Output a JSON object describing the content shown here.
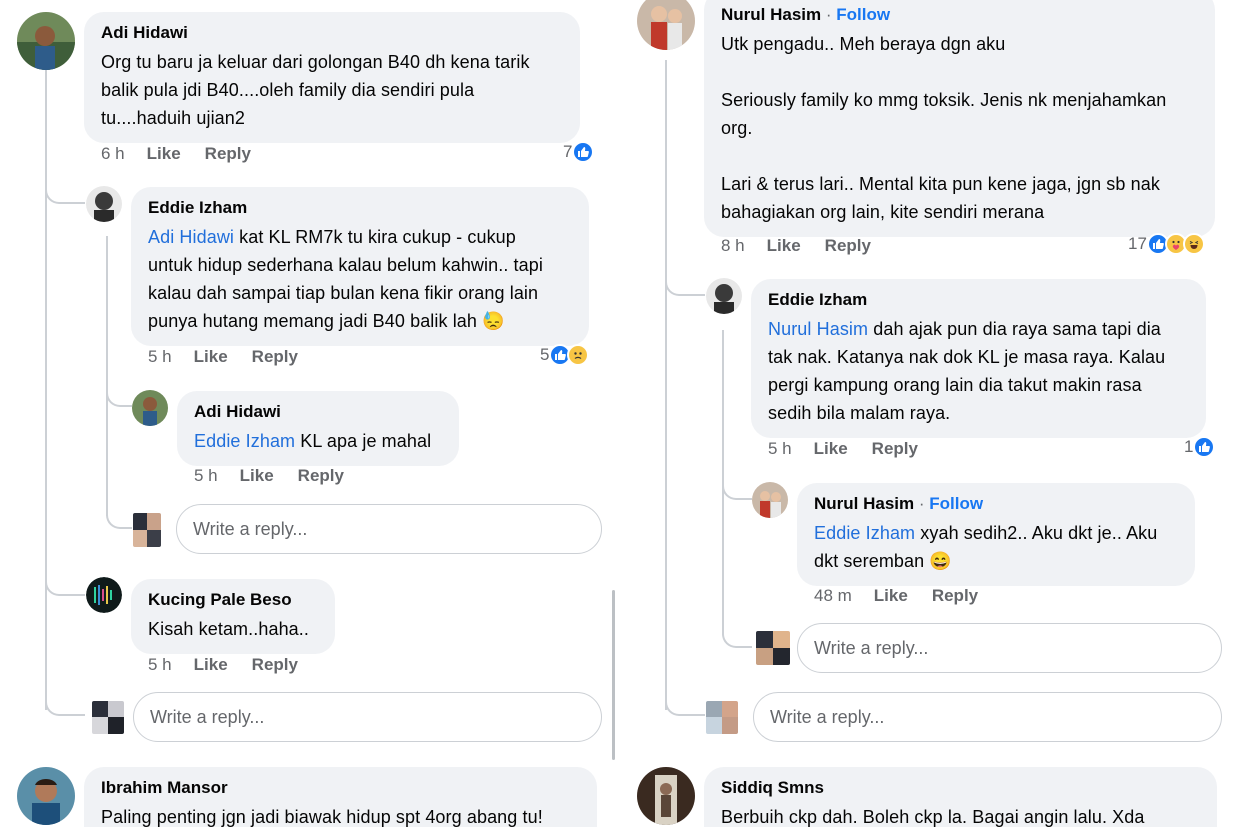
{
  "left": {
    "c1": {
      "author": "Adi Hidawi",
      "text": "Org tu baru ja keluar dari golongan B40 dh kena tarik\nbalik pula jdi B40....oleh family dia sendiri pula\ntu....haduih ujian2",
      "time": "6 h",
      "like": "Like",
      "reply": "Reply",
      "reactions": "7"
    },
    "c2": {
      "author": "Eddie Izham",
      "mention": "Adi Hidawi",
      "text": "  kat KL RM7k tu kira cukup - cukup\nuntuk hidup sederhana kalau belum kahwin.. tapi\nkalau dah sampai tiap bulan kena fikir orang lain\npunya hutang memang jadi B40 balik lah 😓",
      "time": "5 h",
      "like": "Like",
      "reply": "Reply",
      "reactions": "5"
    },
    "c3": {
      "author": "Adi Hidawi",
      "mention": "Eddie Izham",
      "text": " KL apa je mahal",
      "time": "5 h",
      "like": "Like",
      "reply": "Reply"
    },
    "reply1": {
      "placeholder": "Write a reply..."
    },
    "c4": {
      "author": "Kucing Pale Beso",
      "text": "Kisah ketam..haha..",
      "time": "5 h",
      "like": "Like",
      "reply": "Reply"
    },
    "reply2": {
      "placeholder": "Write a reply..."
    },
    "c5": {
      "author": "Ibrahim Mansor",
      "text": "Paling penting jgn jadi biawak hidup spt 4org abang tu!"
    }
  },
  "right": {
    "c1": {
      "author": "Nurul Hasim",
      "sep": " · ",
      "follow": "Follow",
      "text": "Utk pengadu.. Meh beraya dgn aku\n\nSeriously family ko mmg toksik. Jenis nk menjahamkan\norg.\n\nLari & terus lari.. Mental kita pun kene jaga, jgn sb nak\nbahagiakan org lain, kite sendiri merana",
      "time": "8 h",
      "like": "Like",
      "reply": "Reply",
      "reactions": "17"
    },
    "c2": {
      "author": "Eddie Izham",
      "mention": "Nurul Hasim",
      "text": "  dah ajak pun dia raya sama tapi dia\ntak nak. Katanya nak dok KL je masa raya. Kalau\npergi kampung orang lain dia takut makin rasa\nsedih bila malam raya.",
      "time": "5 h",
      "like": "Like",
      "reply": "Reply",
      "reactions": "1"
    },
    "c3": {
      "author": "Nurul Hasim",
      "sep": " · ",
      "follow": "Follow",
      "mention": "Eddie Izham",
      "text": " xyah sedih2.. Aku dkt je.. Aku\ndkt seremban 😄",
      "time": "48 m",
      "like": "Like",
      "reply": "Reply"
    },
    "reply1": {
      "placeholder": "Write a reply..."
    },
    "reply2": {
      "placeholder": "Write a reply..."
    },
    "c4": {
      "author": "Siddiq Smns",
      "text": "Berbuih ckp dah. Boleh ckp la. Bagai angin lalu. Xda"
    }
  },
  "icons": {
    "like_color": "#1877f2",
    "mention_color": "#216fdb",
    "bubble_bg": "#f0f2f5"
  }
}
